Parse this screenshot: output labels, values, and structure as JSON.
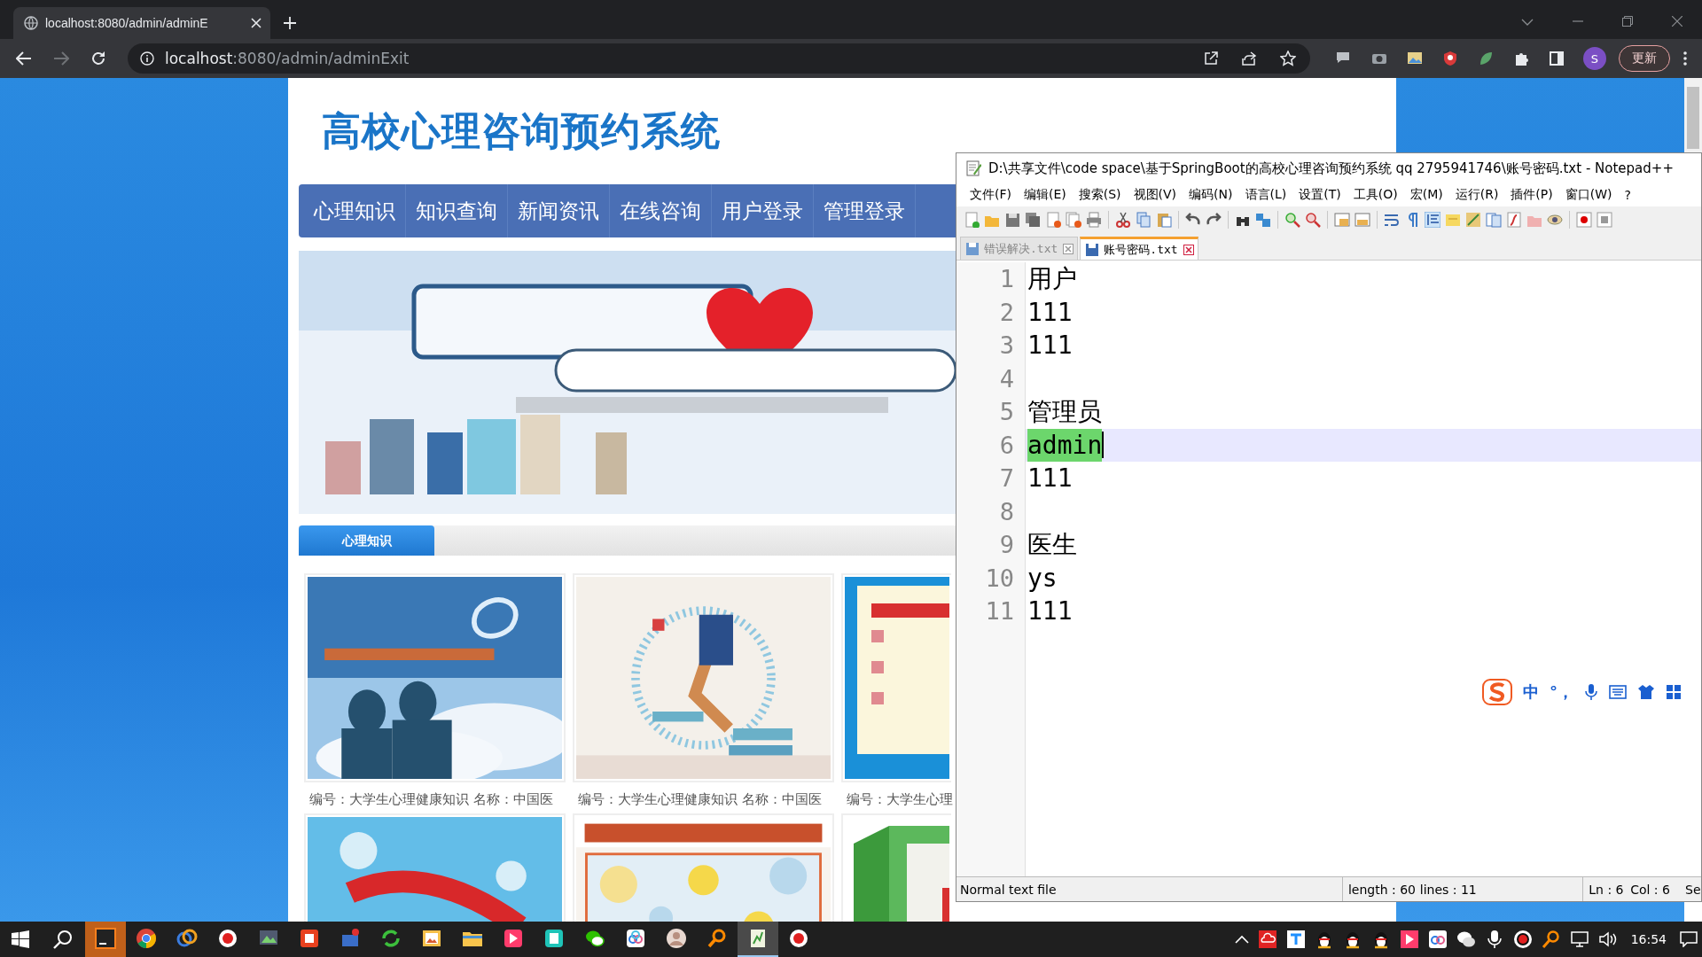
{
  "browser": {
    "tabs": [
      {
        "title": "localhost:8080/admin/adminE",
        "selected": true
      }
    ],
    "address": {
      "host": "localhost",
      "path": ":8080/admin/adminExit"
    },
    "profile": "S",
    "update_button": "更新"
  },
  "page": {
    "site_title": "高校心理咨询预约系统",
    "nav": [
      "心理知识",
      "知识查询",
      "新闻资讯",
      "在线咨询",
      "用户登录",
      "管理登录"
    ],
    "banner": {
      "kind": "picture"
    },
    "section_tabs": [
      {
        "label": "心理知识",
        "selected": true
      }
    ],
    "cards": [
      {
        "kind": "picture",
        "caption": "编号：大学生心理健康知识 名称：中国医"
      },
      {
        "kind": "picture",
        "caption": "编号：大学生心理健康知识 名称：中国医"
      },
      {
        "kind": "picture",
        "caption": "编号：大学生心理"
      },
      {
        "kind": "picture"
      },
      {
        "kind": "picture"
      },
      {
        "kind": "picture"
      }
    ]
  },
  "notepad": {
    "title": "D:\\共享文件\\code space\\基于SpringBoot的高校心理咨询预约系统 qq 2795941746\\账号密码.txt - Notepad++",
    "menu": [
      "文件(F)",
      "编辑(E)",
      "搜索(S)",
      "视图(V)",
      "编码(N)",
      "语言(L)",
      "设置(T)",
      "工具(O)",
      "宏(M)",
      "运行(R)",
      "插件(P)",
      "窗口(W)",
      "?"
    ],
    "tabs": [
      {
        "label": "错误解决.txt",
        "selected": false
      },
      {
        "label": "账号密码.txt",
        "selected": true
      }
    ],
    "lines": [
      {
        "number": "1",
        "text": "用户",
        "current": false,
        "selected": false
      },
      {
        "number": "2",
        "text": "111",
        "current": false,
        "selected": false
      },
      {
        "number": "3",
        "text": "111",
        "current": false,
        "selected": false
      },
      {
        "number": "4",
        "current": false,
        "selected": false
      },
      {
        "number": "5",
        "text": "管理员",
        "current": false,
        "selected": false
      },
      {
        "number": "6",
        "text": "admin",
        "current": true,
        "selected": true
      },
      {
        "number": "7",
        "text": "111",
        "current": false,
        "selected": false
      },
      {
        "number": "8",
        "current": false,
        "selected": false
      },
      {
        "number": "9",
        "text": "医生",
        "current": false,
        "selected": false
      },
      {
        "number": "10",
        "text": "ys",
        "current": false,
        "selected": false
      },
      {
        "number": "11",
        "text": "111",
        "current": false,
        "selected": false
      }
    ],
    "status": {
      "file_type": "Normal text file",
      "length": "length : 60",
      "lines": "lines : 11",
      "ln": "Ln : 6",
      "col": "Col : 6",
      "extra": "Se"
    }
  },
  "ime_toolbar": {
    "mode": "中",
    "punctuation": "°，"
  },
  "taskbar": {
    "clock": "16:54"
  }
}
